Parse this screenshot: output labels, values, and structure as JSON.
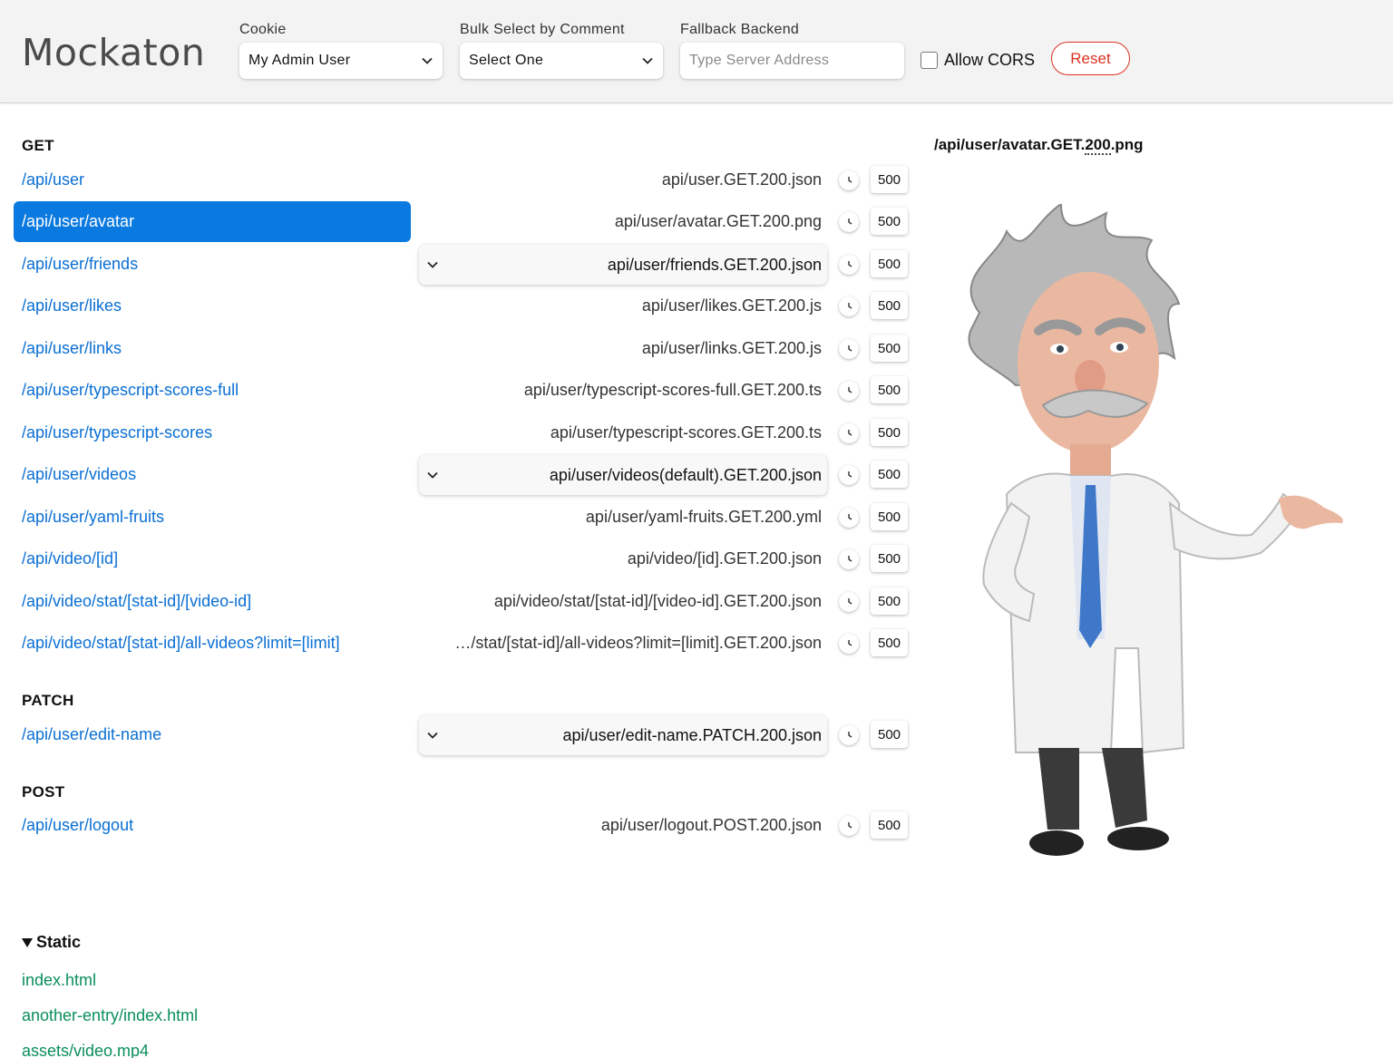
{
  "header": {
    "logo": "Mockaton",
    "cookie": {
      "label": "Cookie",
      "value": "My Admin User"
    },
    "bulk": {
      "label": "Bulk Select by Comment",
      "value": "Select One"
    },
    "fallback": {
      "label": "Fallback Backend",
      "placeholder": "Type Server Address"
    },
    "cors_label": "Allow CORS",
    "reset_label": "Reset"
  },
  "sections": {
    "get_title": "GET",
    "patch_title": "PATCH",
    "post_title": "POST"
  },
  "routes": [
    {
      "url": "/api/user",
      "mock": "api/user.GET.200.json",
      "dropdown": false,
      "selected": false,
      "delay_label": "500"
    },
    {
      "url": "/api/user/avatar",
      "mock": "api/user/avatar.GET.200.png",
      "dropdown": false,
      "selected": true,
      "delay_label": "500"
    },
    {
      "url": "/api/user/friends",
      "mock": "api/user/friends.GET.200.json",
      "dropdown": true,
      "selected": false,
      "delay_label": "500"
    },
    {
      "url": "/api/user/likes",
      "mock": "api/user/likes.GET.200.js",
      "dropdown": false,
      "selected": false,
      "delay_label": "500"
    },
    {
      "url": "/api/user/links",
      "mock": "api/user/links.GET.200.js",
      "dropdown": false,
      "selected": false,
      "delay_label": "500"
    },
    {
      "url": "/api/user/typescript-scores-full",
      "mock": "api/user/typescript-scores-full.GET.200.ts",
      "dropdown": false,
      "selected": false,
      "delay_label": "500"
    },
    {
      "url": "/api/user/typescript-scores",
      "mock": "api/user/typescript-scores.GET.200.ts",
      "dropdown": false,
      "selected": false,
      "delay_label": "500"
    },
    {
      "url": "/api/user/videos",
      "mock": "api/user/videos(default).GET.200.json",
      "dropdown": true,
      "selected": false,
      "delay_label": "500"
    },
    {
      "url": "/api/user/yaml-fruits",
      "mock": "api/user/yaml-fruits.GET.200.yml",
      "dropdown": false,
      "selected": false,
      "delay_label": "500"
    },
    {
      "url": "/api/video/[id]",
      "mock": "api/video/[id].GET.200.json",
      "dropdown": false,
      "selected": false,
      "delay_label": "500"
    },
    {
      "url": "/api/video/stat/[stat-id]/[video-id]",
      "mock": "api/video/stat/[stat-id]/[video-id].GET.200.json",
      "dropdown": false,
      "selected": false,
      "delay_label": "500"
    },
    {
      "url": "/api/video/stat/[stat-id]/all-videos?limit=[limit]",
      "mock": "…/stat/[stat-id]/all-videos?limit=[limit].GET.200.json",
      "dropdown": false,
      "selected": false,
      "delay_label": "500"
    },
    {
      "url": "/api/user/edit-name",
      "mock": "api/user/edit-name.PATCH.200.json",
      "dropdown": true,
      "selected": false,
      "delay_label": "500"
    },
    {
      "url": "/api/user/logout",
      "mock": "api/user/logout.POST.200.json",
      "dropdown": false,
      "selected": false,
      "delay_label": "500"
    }
  ],
  "preview": {
    "title_prefix": "/api/user/avatar.GET.",
    "title_status": "200",
    "title_suffix": ".png"
  },
  "static": {
    "title": "Static",
    "items": [
      "index.html",
      "another-entry/index.html",
      "assets/video.mp4"
    ]
  },
  "colors": {
    "link_blue": "#0a6fd4",
    "selected_bg": "#0a79e0",
    "static_green": "#0a8f5a",
    "reset_red": "#dd3322"
  }
}
